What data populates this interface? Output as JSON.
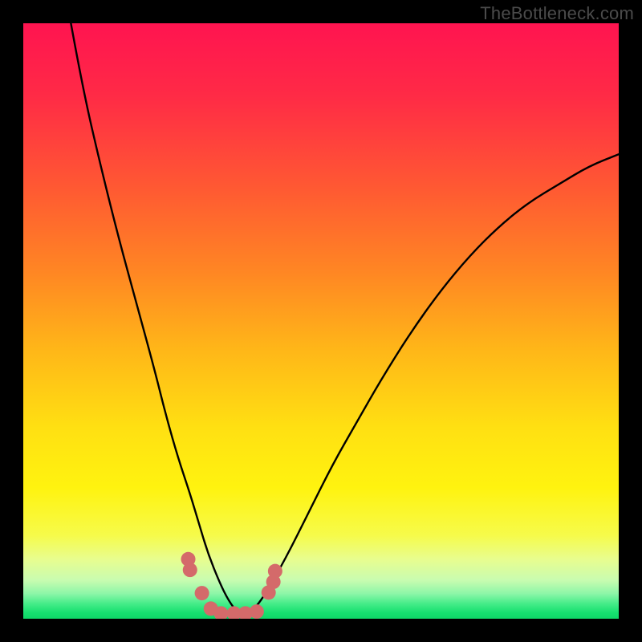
{
  "watermark": "TheBottleneck.com",
  "chart_data": {
    "type": "line",
    "title": "",
    "xlabel": "",
    "ylabel": "",
    "xlim": [
      0,
      100
    ],
    "ylim": [
      0,
      100
    ],
    "grid": false,
    "legend": false,
    "series": [
      {
        "name": "curve",
        "x": [
          8,
          10,
          13,
          16,
          19,
          22,
          24,
          26,
          28,
          29.5,
          31,
          33,
          34.5,
          36,
          38,
          40,
          44,
          48,
          52,
          56,
          60,
          65,
          70,
          75,
          80,
          85,
          90,
          95,
          100
        ],
        "y": [
          100,
          89,
          76,
          64,
          53,
          42,
          34,
          27,
          21,
          16,
          11,
          6,
          3,
          1,
          1,
          3,
          10,
          18,
          26,
          33,
          40,
          48,
          55,
          61,
          66,
          70,
          73,
          76,
          78
        ]
      }
    ],
    "markers": {
      "name": "bottom-cluster",
      "color": "#d46a6a",
      "points": [
        {
          "x": 27.7,
          "y": 10.0
        },
        {
          "x": 28.0,
          "y": 8.2
        },
        {
          "x": 30.0,
          "y": 4.3
        },
        {
          "x": 31.5,
          "y": 1.7
        },
        {
          "x": 33.2,
          "y": 0.9
        },
        {
          "x": 35.4,
          "y": 0.9
        },
        {
          "x": 37.3,
          "y": 0.9
        },
        {
          "x": 39.2,
          "y": 1.2
        },
        {
          "x": 41.2,
          "y": 4.4
        },
        {
          "x": 42.0,
          "y": 6.2
        },
        {
          "x": 42.3,
          "y": 8.0
        }
      ]
    },
    "background_gradient_stops": [
      {
        "offset": 0.0,
        "color": "#ff1450"
      },
      {
        "offset": 0.12,
        "color": "#ff2a46"
      },
      {
        "offset": 0.28,
        "color": "#ff5a32"
      },
      {
        "offset": 0.42,
        "color": "#ff8723"
      },
      {
        "offset": 0.55,
        "color": "#ffb718"
      },
      {
        "offset": 0.68,
        "color": "#ffe012"
      },
      {
        "offset": 0.78,
        "color": "#fff30f"
      },
      {
        "offset": 0.86,
        "color": "#f6fb4a"
      },
      {
        "offset": 0.9,
        "color": "#e8fd8f"
      },
      {
        "offset": 0.935,
        "color": "#c9fcb0"
      },
      {
        "offset": 0.958,
        "color": "#8cf6a8"
      },
      {
        "offset": 0.975,
        "color": "#44ec88"
      },
      {
        "offset": 0.99,
        "color": "#16e06f"
      },
      {
        "offset": 1.0,
        "color": "#0fd768"
      }
    ]
  }
}
